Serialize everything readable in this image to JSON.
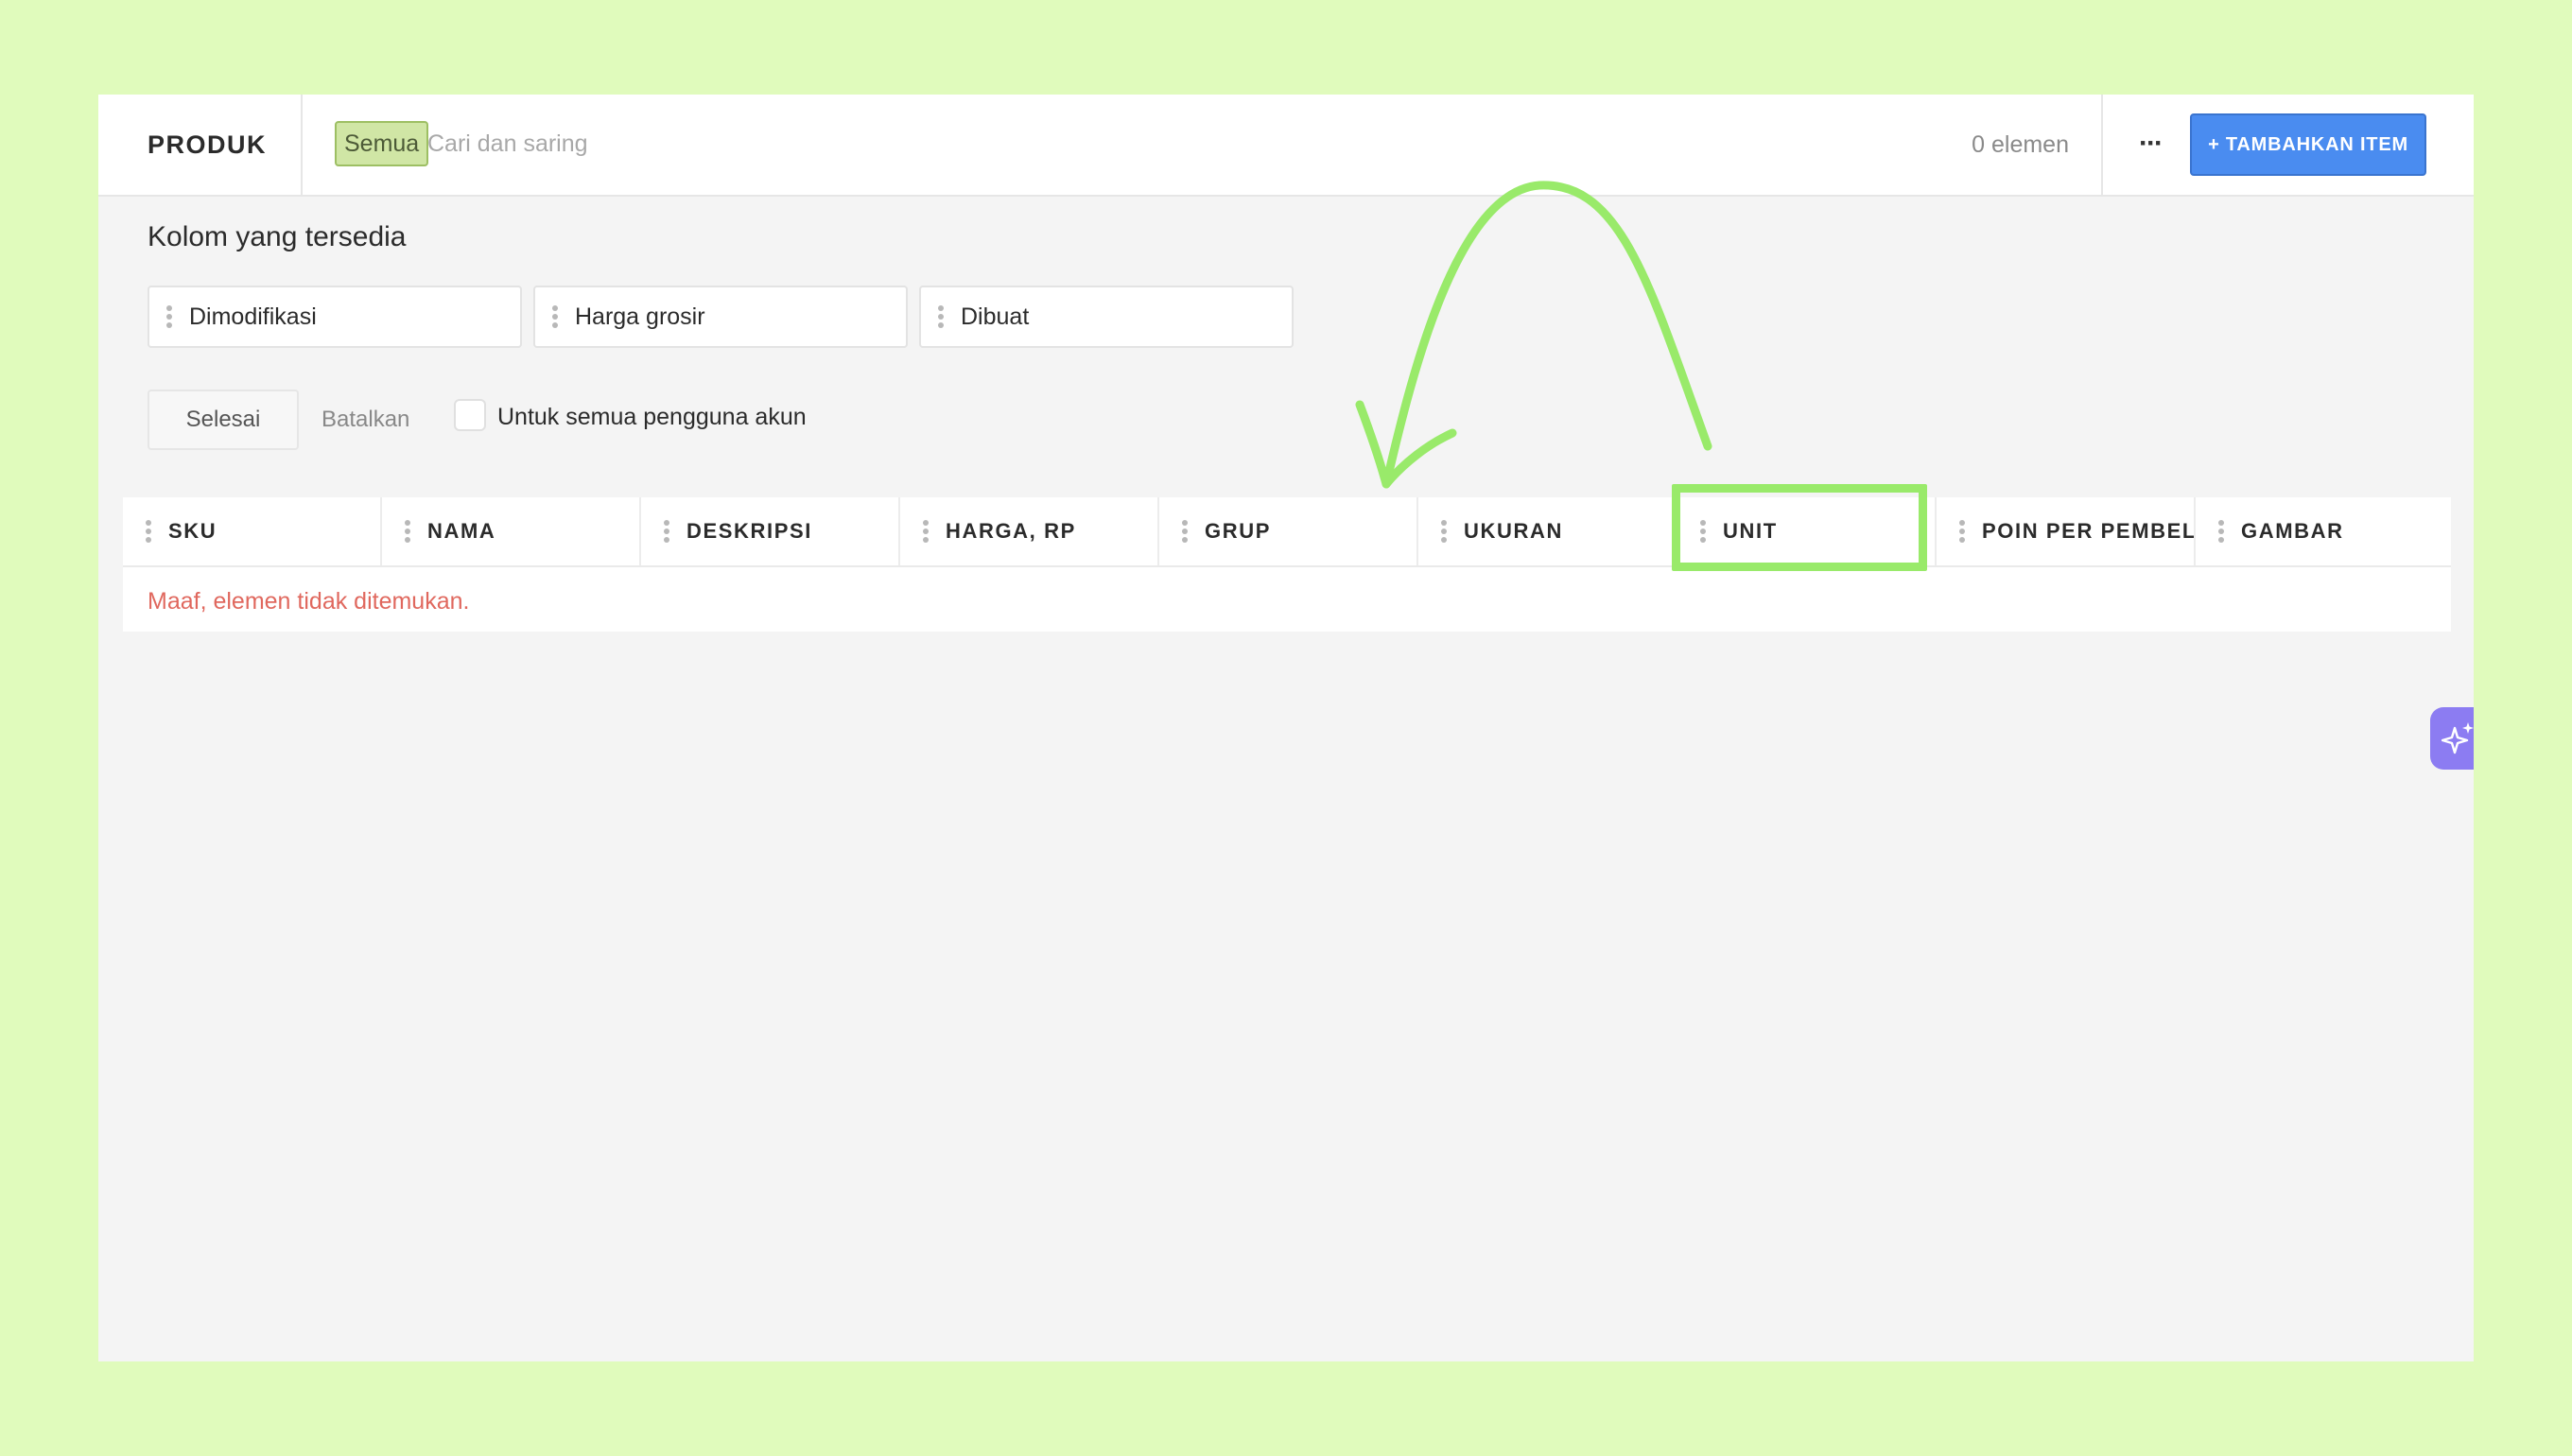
{
  "header": {
    "title": "PRODUK",
    "filter_chip": "Semua",
    "search_placeholder": "Cari dan saring",
    "count": "0 elemen",
    "more_label": "···",
    "add_button": "+ TAMBAHKAN ITEM"
  },
  "available_columns": {
    "title": "Kolom yang tersedia",
    "items": [
      "Dimodifikasi",
      "Harga grosir",
      "Dibuat"
    ]
  },
  "actions": {
    "done": "Selesai",
    "cancel": "Batalkan",
    "all_users_label": "Untuk semua pengguna akun",
    "all_users_checked": false
  },
  "table": {
    "columns": [
      "SKU",
      "NAMA",
      "DESKRIPSI",
      "HARGA, RP",
      "GRUP",
      "UKURAN",
      "UNIT",
      "POIN PER PEMBELIAN",
      "GAMBAR"
    ],
    "empty_message": "Maaf, elemen tidak ditemukan."
  },
  "annotation": {
    "highlighted_column": "UNIT",
    "color": "#99ea6a"
  },
  "colors": {
    "background": "#e0fbbc",
    "primary_button": "#4a8cf0",
    "empty_text": "#e0685e",
    "ai_button": "#8c7cf2"
  }
}
